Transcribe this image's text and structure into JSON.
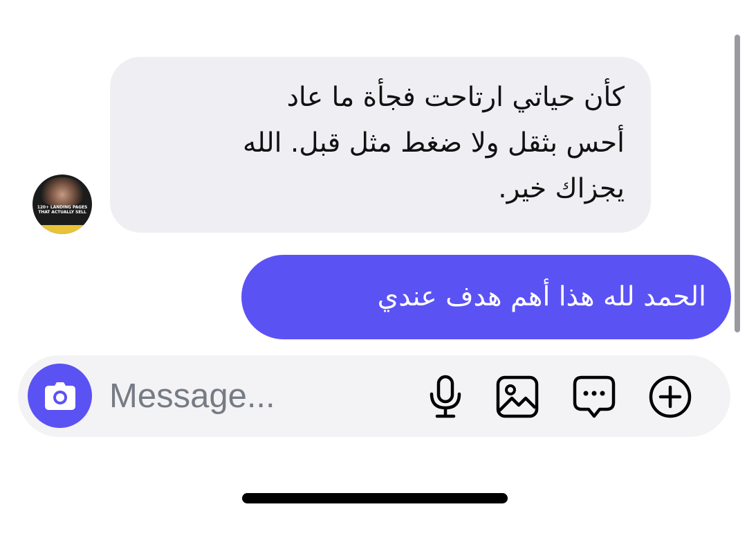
{
  "thread": {
    "incoming_message": {
      "avatar_caption": "120+ LANDING PAGES THAT ACTUALLY SELL",
      "lines": [
        "كأن حياتي ارتاحت فجأة ما عاد",
        "أحس بثقل ولا ضغط مثل قبل. الله",
        "يجزاك خير."
      ]
    },
    "outgoing_message": {
      "text": "الحمد لله هذا أهم هدف عندي"
    }
  },
  "composer": {
    "placeholder": "Message...",
    "value": "",
    "buttons": {
      "camera": "camera-icon",
      "mic": "microphone-icon",
      "gallery": "image-icon",
      "sticker": "chat-bubble-icon",
      "plus": "plus-circle-icon"
    }
  },
  "colors": {
    "accent": "#5b52f4",
    "incoming_bubble": "#efeff3",
    "composer_bg": "#f3f3f5",
    "placeholder": "#767b84"
  }
}
